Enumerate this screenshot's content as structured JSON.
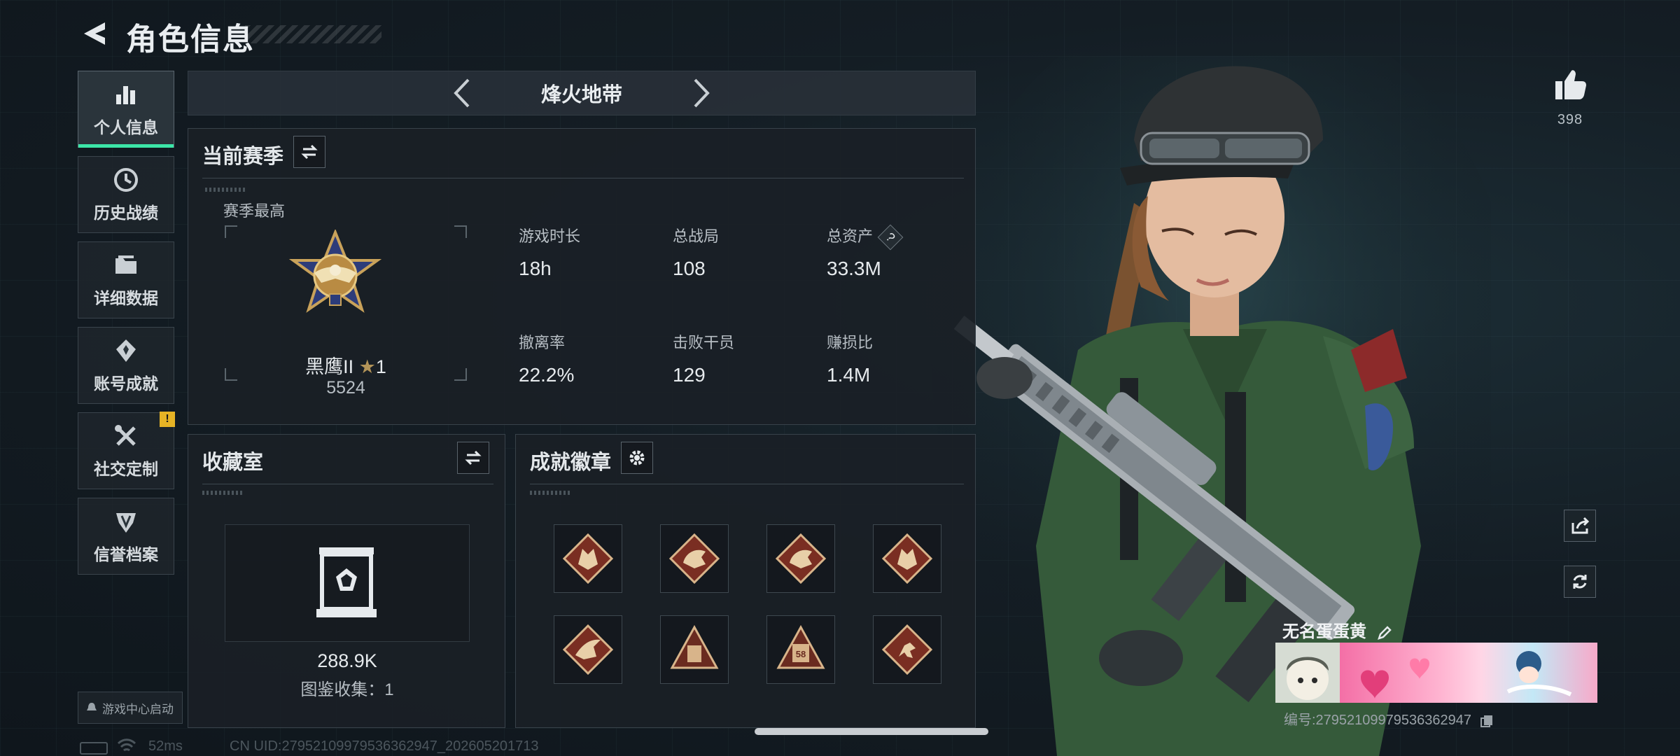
{
  "header": {
    "title": "角色信息"
  },
  "sidebar": {
    "items": [
      {
        "label": "个人信息",
        "icon": "bar-chart-icon",
        "active": true
      },
      {
        "label": "历史战绩",
        "icon": "clock-icon"
      },
      {
        "label": "详细数据",
        "icon": "folder-icon"
      },
      {
        "label": "账号成就",
        "icon": "achievement-icon"
      },
      {
        "label": "社交定制",
        "icon": "tools-icon",
        "badge": "!"
      },
      {
        "label": "信誉档案",
        "icon": "shield-icon"
      }
    ],
    "launch_label": "游戏中心启动"
  },
  "mode": {
    "label": "烽火地带"
  },
  "season": {
    "title": "当前赛季",
    "best_label": "赛季最高",
    "rank_name": "黑鹰II",
    "rank_star": "1",
    "rank_score": "5524",
    "stats": [
      {
        "label": "游戏时长",
        "value": "18h"
      },
      {
        "label": "总战局",
        "value": "108"
      },
      {
        "label": "总资产",
        "value": "33.3M",
        "help": "?"
      },
      {
        "label": "撤离率",
        "value": "22.2%"
      },
      {
        "label": "击败干员",
        "value": "129"
      },
      {
        "label": "赚损比",
        "value": "1.4M"
      }
    ]
  },
  "collection": {
    "title": "收藏室",
    "value": "288.9K",
    "catalog_text": "图鉴收集：1"
  },
  "badges": {
    "title": "成就徽章",
    "items": [
      {
        "icon": "wolf-badge-icon"
      },
      {
        "icon": "dragon-badge-icon"
      },
      {
        "icon": "dragon-badge-icon"
      },
      {
        "icon": "wolf-badge-icon"
      },
      {
        "icon": "eagle-badge-icon"
      },
      {
        "icon": "pyramid-badge-icon"
      },
      {
        "icon": "pyramid-badge-icon",
        "text": "58"
      },
      {
        "icon": "runner-badge-icon"
      }
    ]
  },
  "profile": {
    "like_count": "398",
    "player_name": "无名蛋蛋黄",
    "uid_text": "编号:279521099795363629​47"
  },
  "footer": {
    "ping": "52ms",
    "uid_text": "CN UID:279521099795363629​47_202605201713"
  },
  "colors": {
    "accent": "#3ce6a8",
    "badge_yellow": "#e6b325"
  }
}
